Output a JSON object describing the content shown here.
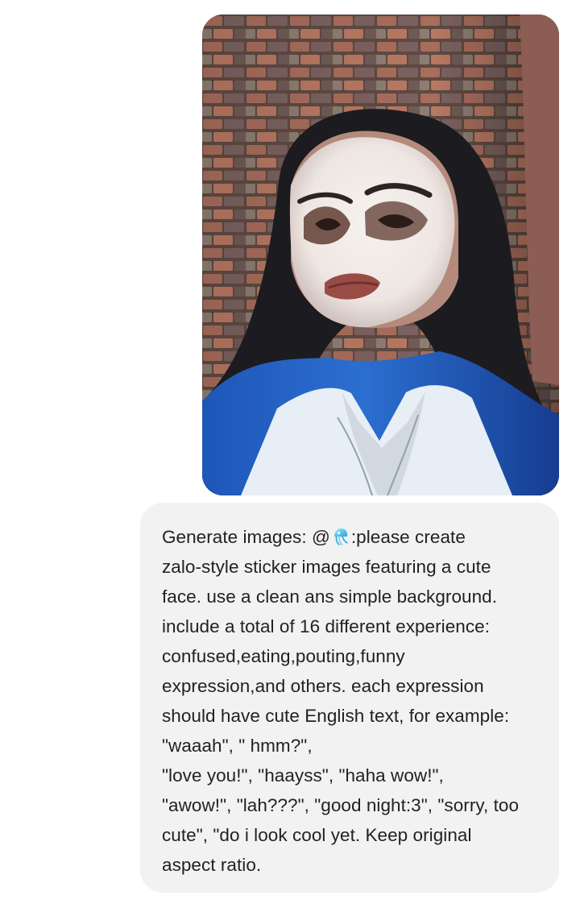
{
  "message": {
    "lines": [
      {
        "before_icon": "Generate images: @",
        "after_icon": ":please create"
      },
      "zalo-style sticker images featuring a cute",
      "face. use a clean ans simple background.",
      "include a total of 16 different experience:",
      "confused,eating,pouting,funny",
      "expression,and others. each expression",
      "should have cute English text, for example:",
      "\"waaah\", \" hmm?\",",
      "\"love you!\", \"haayss\", \"haha wow!\",",
      "\"awow!\", \"lah???\", \"good night:3\", \"sorry, too",
      "cute\", \"do i look cool yet. Keep original",
      "aspect ratio."
    ],
    "mention_icon": "jellyfish-icon"
  },
  "colors": {
    "page_background": "#ffffff",
    "bubble_background": "#f2f2f2",
    "text": "#222222",
    "shirt_blue": "#245fc2"
  }
}
